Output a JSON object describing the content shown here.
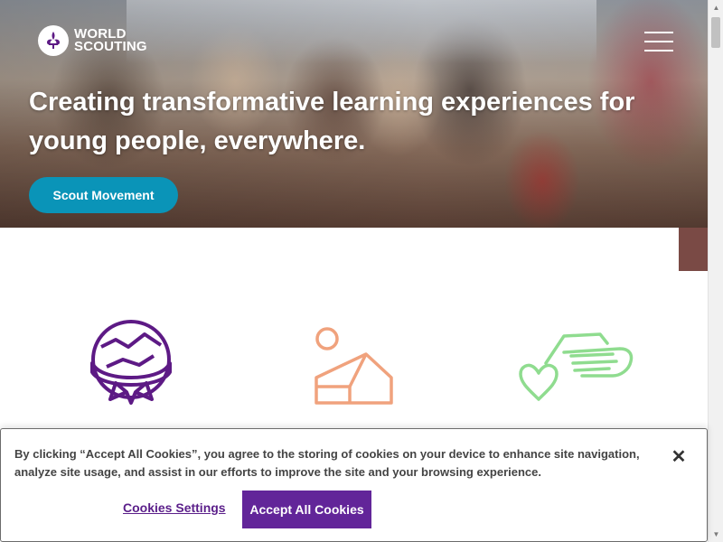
{
  "header": {
    "logo_line1": "WORLD",
    "logo_line2": "SCOUTING",
    "menu_icon": "hamburger-icon"
  },
  "hero": {
    "title": "Creating transformative learning experiences for young people, everywhere.",
    "cta_label": "Scout Movement"
  },
  "features": {
    "icons": [
      "globe-scarf-icon",
      "sun-tent-icon",
      "heart-hand-icon"
    ],
    "colors": [
      "#5d1a85",
      "#f0a27d",
      "#8fdc8f"
    ]
  },
  "cookie_banner": {
    "text": "By clicking “Accept All Cookies”, you agree to the storing of cookies on your device to enhance site navigation, analyze site usage, and assist in our efforts to improve the site and your browsing experience.",
    "settings_label": "Cookies Settings",
    "accept_label": "Accept All Cookies",
    "close_icon": "close-icon"
  },
  "colors": {
    "cta": "#0a94b8",
    "accent_purple": "#622599"
  }
}
